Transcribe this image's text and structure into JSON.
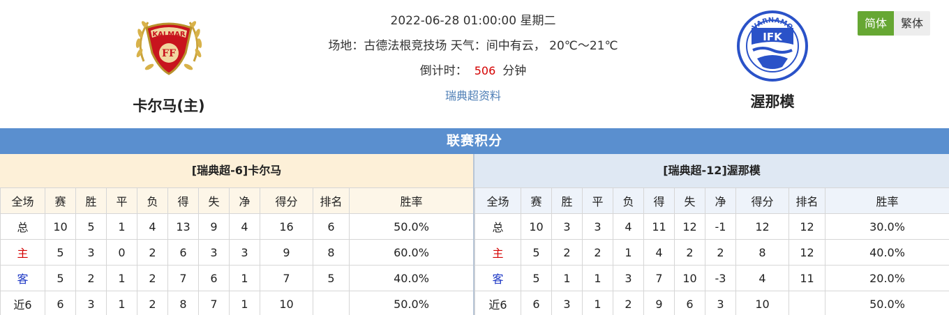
{
  "match": {
    "datetime": "2022-06-28 01:00:00",
    "weekday": "星期二",
    "venue_label": "场地：",
    "venue": "古德法根竞技场",
    "weather_label": "天气：",
    "weather": "间中有云，",
    "temperature": "20℃～21℃",
    "countdown_label": "倒计时：",
    "countdown_value": "506",
    "countdown_unit": "分钟",
    "league_link": "瑞典超资料"
  },
  "home_team": {
    "name": "卡尔马(主)",
    "logo_text_top": "KALMAR",
    "logo_text_mid": "FF"
  },
  "away_team": {
    "name": "渥那模",
    "logo_text_top": "VARNAMO",
    "logo_text_mid": "IFK"
  },
  "language": {
    "simplified": "简体",
    "traditional": "繁体"
  },
  "colors": {
    "accent": "#5a8fcf",
    "lang_active": "#66a733",
    "countdown": "#d40000",
    "link": "#4f7fb6"
  },
  "standings": {
    "title": "联赛积分",
    "columns": [
      "全场",
      "赛",
      "胜",
      "平",
      "负",
      "得",
      "失",
      "净",
      "得分",
      "排名",
      "胜率"
    ],
    "home": {
      "title": "[瑞典超-6]卡尔马",
      "rows": [
        [
          "总",
          "10",
          "5",
          "1",
          "4",
          "13",
          "9",
          "4",
          "16",
          "6",
          "50.0%"
        ],
        [
          "主",
          "5",
          "3",
          "0",
          "2",
          "6",
          "3",
          "3",
          "9",
          "8",
          "60.0%"
        ],
        [
          "客",
          "5",
          "2",
          "1",
          "2",
          "7",
          "6",
          "1",
          "7",
          "5",
          "40.0%"
        ],
        [
          "近6",
          "6",
          "3",
          "1",
          "2",
          "8",
          "7",
          "1",
          "10",
          "",
          "50.0%"
        ]
      ]
    },
    "away": {
      "title": "[瑞典超-12]渥那模",
      "rows": [
        [
          "总",
          "10",
          "3",
          "3",
          "4",
          "11",
          "12",
          "-1",
          "12",
          "12",
          "30.0%"
        ],
        [
          "主",
          "5",
          "2",
          "2",
          "1",
          "4",
          "2",
          "2",
          "8",
          "12",
          "40.0%"
        ],
        [
          "客",
          "5",
          "1",
          "1",
          "3",
          "7",
          "10",
          "-3",
          "4",
          "11",
          "20.0%"
        ],
        [
          "近6",
          "6",
          "3",
          "1",
          "2",
          "9",
          "6",
          "3",
          "10",
          "",
          "50.0%"
        ]
      ]
    }
  }
}
